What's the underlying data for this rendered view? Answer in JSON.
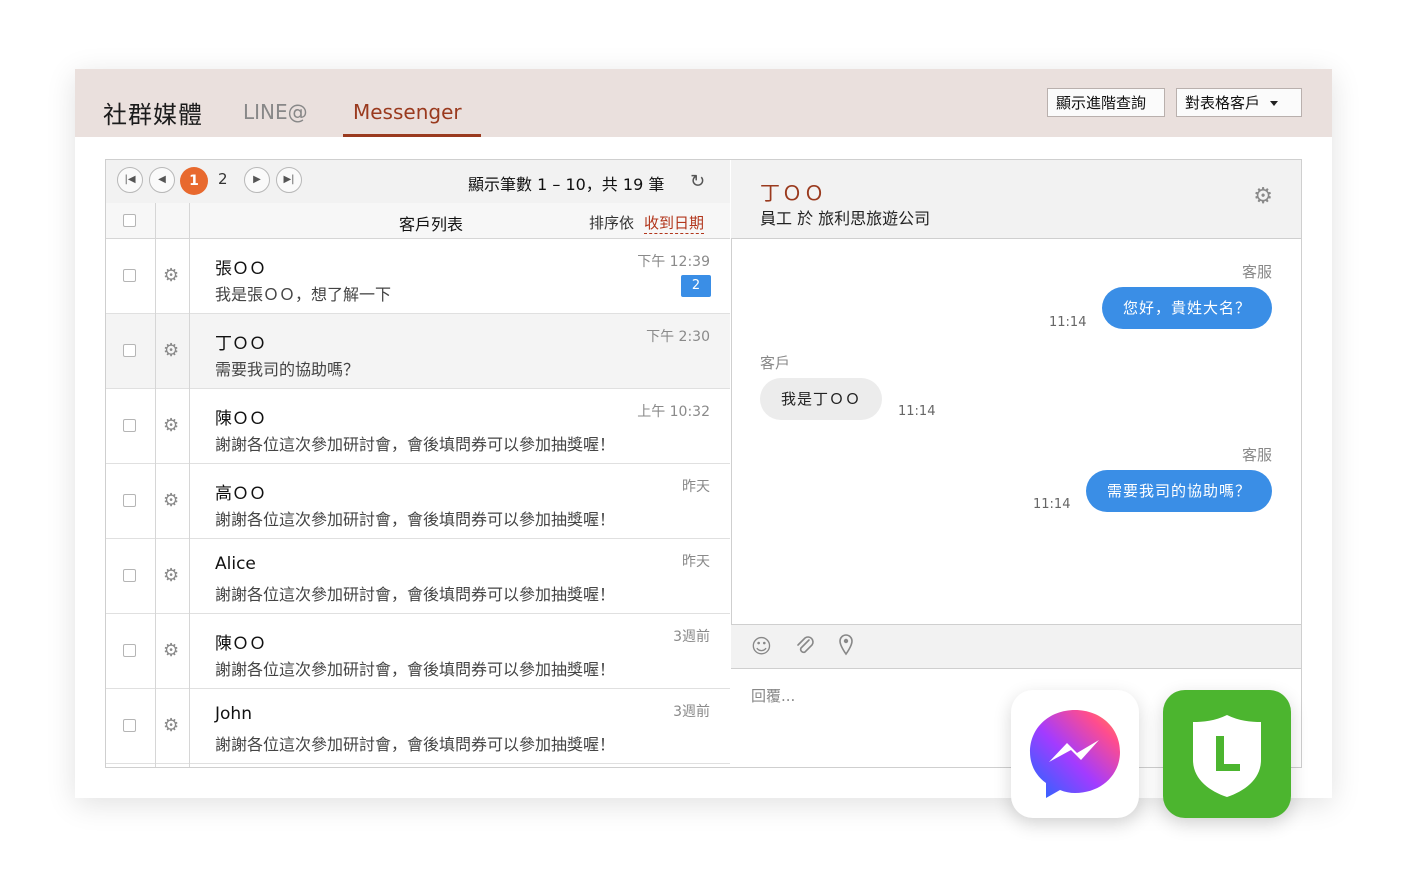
{
  "header": {
    "brand": "社群媒體",
    "tabs": [
      "LINE@",
      "Messenger"
    ],
    "active_tab": "Messenger",
    "advanced_search_label": "顯示進階查詢",
    "table_customers_label": "對表格客戶"
  },
  "pager": {
    "current_page": "1",
    "next_page": "2",
    "count_text": "顯示筆數 1 – 10，共 19 筆"
  },
  "list": {
    "title": "客戶列表",
    "sort_label": "排序依",
    "sort_value": "收到日期",
    "rows": [
      {
        "name": "張ＯＯ",
        "message": "我是張ＯＯ，想了解一下",
        "time": "下午 12:39",
        "badge": "2"
      },
      {
        "name": "丁ＯＯ",
        "message": "需要我司的協助嗎？",
        "time": "下午 2:30",
        "badge": ""
      },
      {
        "name": "陳ＯＯ",
        "message": "謝謝各位這次參加研討會，會後填問券可以參加抽獎喔！",
        "time": "上午 10:32",
        "badge": ""
      },
      {
        "name": "高ＯＯ",
        "message": "謝謝各位這次參加研討會，會後填問券可以參加抽獎喔！",
        "time": "昨天",
        "badge": ""
      },
      {
        "name": "Alice",
        "message": "謝謝各位這次參加研討會，會後填問券可以參加抽獎喔！",
        "time": "昨天",
        "badge": ""
      },
      {
        "name": "陳ＯＯ",
        "message": "謝謝各位這次參加研討會，會後填問券可以參加抽獎喔！",
        "time": "3週前",
        "badge": ""
      },
      {
        "name": "John",
        "message": "謝謝各位這次參加研討會，會後填問券可以參加抽獎喔！",
        "time": "3週前",
        "badge": ""
      }
    ]
  },
  "chat": {
    "contact_name": "丁ＯＯ",
    "contact_subtitle": "員工 於 旅利思旅遊公司",
    "messages": [
      {
        "sender": "客服",
        "text": "您好，貴姓大名？",
        "time": "11:14",
        "direction": "out"
      },
      {
        "sender": "客戶",
        "text": "我是丁ＯＯ",
        "time": "11:14",
        "direction": "in"
      },
      {
        "sender": "客服",
        "text": "需要我司的協助嗎？",
        "time": "11:14",
        "direction": "out"
      }
    ],
    "reply_placeholder": "回覆..."
  },
  "icons": {
    "row_gear": "gear-icon",
    "toolbar": [
      "emoji-icon",
      "attachment-icon",
      "location-icon"
    ],
    "apps": [
      "messenger-icon",
      "line-icon"
    ]
  },
  "colors": {
    "accent": "#9a3a1e",
    "pager_active": "#e8692e",
    "bubble_out": "#3a8ee6",
    "badge": "#3a8ee6",
    "line_green": "#4cb52f"
  }
}
